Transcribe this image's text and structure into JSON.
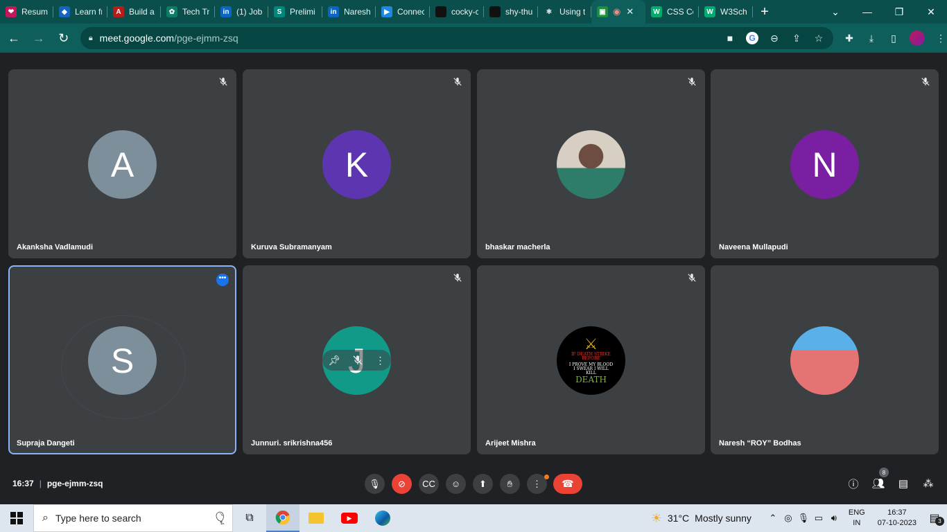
{
  "browser": {
    "tabs": [
      {
        "title": "Resume",
        "fav_color": "#c2185b",
        "fav_glyph": "❤"
      },
      {
        "title": "Learn fr",
        "fav_color": "#1565c0",
        "fav_glyph": "◆"
      },
      {
        "title": "Build a",
        "fav_color": "#b71c1c",
        "fav_glyph": "A"
      },
      {
        "title": "Tech Tr",
        "fav_color": "#0e7c66",
        "fav_glyph": "✿"
      },
      {
        "title": "(1) Jobs",
        "fav_color": "#0a66c2",
        "fav_glyph": "in"
      },
      {
        "title": "Prelimi",
        "fav_color": "#00897b",
        "fav_glyph": "S"
      },
      {
        "title": "Naresh",
        "fav_color": "#0a66c2",
        "fav_glyph": "in"
      },
      {
        "title": "Connec",
        "fav_color": "#1e88e5",
        "fav_glyph": "▶"
      },
      {
        "title": "cocky-c",
        "fav_color": "#111111",
        "fav_glyph": ""
      },
      {
        "title": "shy-thu",
        "fav_color": "#111111",
        "fav_glyph": ""
      },
      {
        "title": "Using t",
        "fav_color": "#0b4f4c",
        "fav_glyph": "⚛"
      },
      {
        "title": "",
        "fav_color": "#1e8e3e",
        "fav_glyph": "▣"
      },
      {
        "title": "CSS Co",
        "fav_color": "#04aa6d",
        "fav_glyph": "W"
      },
      {
        "title": "W3Sch",
        "fav_color": "#04aa6d",
        "fav_glyph": "W"
      }
    ],
    "new_tab": "+",
    "url_host": "meet.google.com",
    "url_path": "/pge-ejmm-zsq"
  },
  "participants": [
    {
      "name": "Akanksha Vadlamudi",
      "initial": "A",
      "color": "#7e8f9c"
    },
    {
      "name": "Kuruva Subramanyam",
      "initial": "K",
      "color": "#5e35b1"
    },
    {
      "name": "bhaskar macherla",
      "initial": "",
      "color": "photo"
    },
    {
      "name": "Naveena Mullapudi",
      "initial": "N",
      "color": "#7b1fa2"
    },
    {
      "name": "Supraja Dangeti",
      "initial": "S",
      "color": "#7e8f9c"
    },
    {
      "name": "Junnuri. srikrishna456",
      "initial": "J",
      "color": "#129a88"
    },
    {
      "name": "Arijeet Mishra",
      "initial": "",
      "color": "photo"
    },
    {
      "name": "Naresh “ROY” Bodhas",
      "initial": "",
      "color": "photo"
    }
  ],
  "arijeet_avatar_text": {
    "line1": "IF DEATH STRIKE",
    "line2": "BEFORE",
    "line3": "I PROVE MY BLOOD",
    "line4": "I SWEAR I WILL",
    "line5": "KILL",
    "line6": "DEATH"
  },
  "meeting": {
    "time": "16:37",
    "code": "pge-ejmm-zsq",
    "people_count": "8"
  },
  "taskbar": {
    "search_placeholder": "Type here to search",
    "weather_temp": "31°C",
    "weather_text": "Mostly sunny",
    "lang_top": "ENG",
    "lang_bottom": "IN",
    "time": "16:37",
    "date": "07-10-2023",
    "notif_count": "3"
  },
  "colors": {
    "tab_strip": "#0b4f4c",
    "toolbar": "#0e5f5c",
    "tile_bg": "#3c4043",
    "meet_bg": "#202124",
    "end_call": "#ea4335",
    "active_border": "#8ab4f8"
  }
}
